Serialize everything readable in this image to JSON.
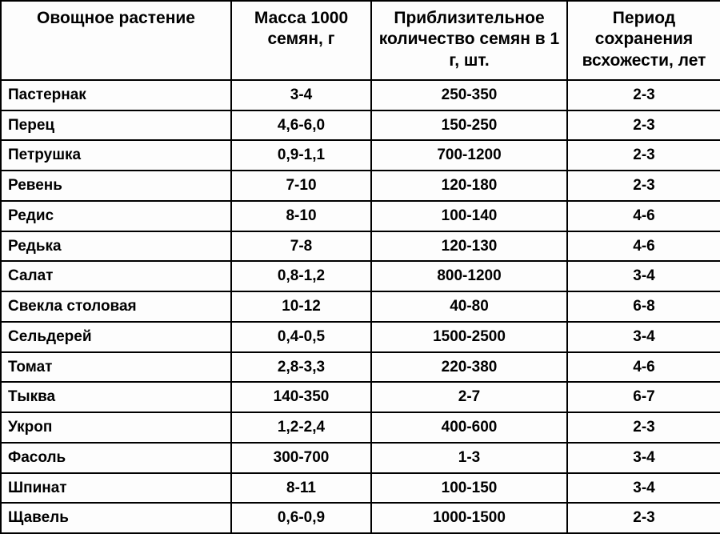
{
  "headers": {
    "plant": "Овощное растение",
    "mass": "Масса 1000 семян, г",
    "count": "Приблизительное количество семян в 1 г, шт.",
    "period": "Период сохранения всхожести, лет"
  },
  "rows": [
    {
      "plant": "Пастернак",
      "mass": "3-4",
      "count": "250-350",
      "period": "2-3"
    },
    {
      "plant": "Перец",
      "mass": "4,6-6,0",
      "count": "150-250",
      "period": "2-3"
    },
    {
      "plant": "Петрушка",
      "mass": "0,9-1,1",
      "count": "700-1200",
      "period": "2-3"
    },
    {
      "plant": "Ревень",
      "mass": "7-10",
      "count": "120-180",
      "period": "2-3"
    },
    {
      "plant": "Редис",
      "mass": "8-10",
      "count": "100-140",
      "period": "4-6"
    },
    {
      "plant": "Редька",
      "mass": "7-8",
      "count": "120-130",
      "period": "4-6"
    },
    {
      "plant": "Салат",
      "mass": "0,8-1,2",
      "count": "800-1200",
      "period": "3-4"
    },
    {
      "plant": "Свекла столовая",
      "mass": "10-12",
      "count": "40-80",
      "period": "6-8"
    },
    {
      "plant": "Сельдерей",
      "mass": "0,4-0,5",
      "count": "1500-2500",
      "period": "3-4"
    },
    {
      "plant": "Томат",
      "mass": "2,8-3,3",
      "count": "220-380",
      "period": "4-6"
    },
    {
      "plant": "Тыква",
      "mass": "140-350",
      "count": "2-7",
      "period": "6-7"
    },
    {
      "plant": "Укроп",
      "mass": "1,2-2,4",
      "count": "400-600",
      "period": "2-3"
    },
    {
      "plant": "Фасоль",
      "mass": "300-700",
      "count": "1-3",
      "period": "3-4"
    },
    {
      "plant": "Шпинат",
      "mass": "8-11",
      "count": "100-150",
      "period": "3-4"
    },
    {
      "plant": "Щавель",
      "mass": "0,6-0,9",
      "count": "1000-1500",
      "period": "2-3"
    }
  ]
}
